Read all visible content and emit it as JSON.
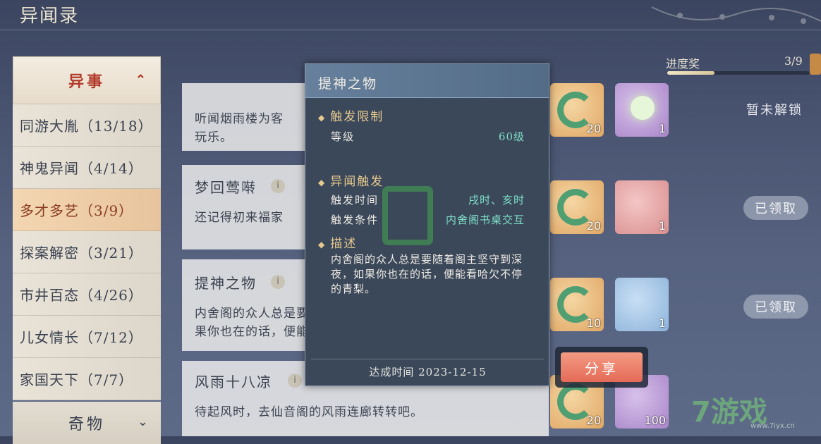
{
  "header": {
    "title": "异闻录"
  },
  "progress": {
    "label": "进度奖",
    "value": "3/9",
    "fraction": 0.33
  },
  "sidebar": {
    "category_header": "异事",
    "items": [
      {
        "label": "同游大胤（13/18）"
      },
      {
        "label": "神鬼异闻（4/14）"
      },
      {
        "label": "多才多艺（3/9）"
      },
      {
        "label": "探案解密（3/21）"
      },
      {
        "label": "市井百态（4/26）"
      },
      {
        "label": "儿女情长（7/12）"
      },
      {
        "label": "家国天下（7/7）"
      }
    ],
    "category_footer": "奇物"
  },
  "entries": [
    {
      "title": "",
      "desc_line1": "听闻烟雨楼为客",
      "desc_line2": "玩乐。",
      "status": "暂未解锁",
      "rewards": [
        "20",
        "1"
      ]
    },
    {
      "title": "梦回莺啭",
      "desc_line1": "还记得初来福家",
      "desc_line2": "",
      "status": "已领取",
      "rewards": [
        "20",
        "1"
      ]
    },
    {
      "title": "提神之物",
      "desc_line1": "内舍阁的众人总是要随着阁主坚守到深夜，如",
      "desc_line2": "果你也在的话，便能看哈欠不停的青梨。",
      "status": "已领取",
      "rewards": [
        "10",
        "1"
      ]
    },
    {
      "title": "风雨十八凉",
      "desc_line1": "待起风时，去仙音阁的风雨连廊转转吧。",
      "desc_line2": "",
      "status": "",
      "rewards": [
        "20",
        "100"
      ]
    }
  ],
  "modal": {
    "title": "提神之物",
    "limit_header": "触发限制",
    "level_label": "等级",
    "level_value": "60级",
    "trigger_header": "异闻触发",
    "time_label": "触发时间",
    "time_value": "戌时、亥时",
    "cond_label": "触发条件",
    "cond_value": "内舍阁书桌交互",
    "desc_header": "描述",
    "desc_text": "内舍阁的众人总是要随着阁主坚守到深夜，如果你也在的话，便能看哈欠不停的青梨。",
    "achieved": "达成时间 2023-12-15"
  },
  "share": {
    "label": "分享"
  },
  "watermark": {
    "site": "7游戏",
    "url": "www.7iyx.cn"
  }
}
